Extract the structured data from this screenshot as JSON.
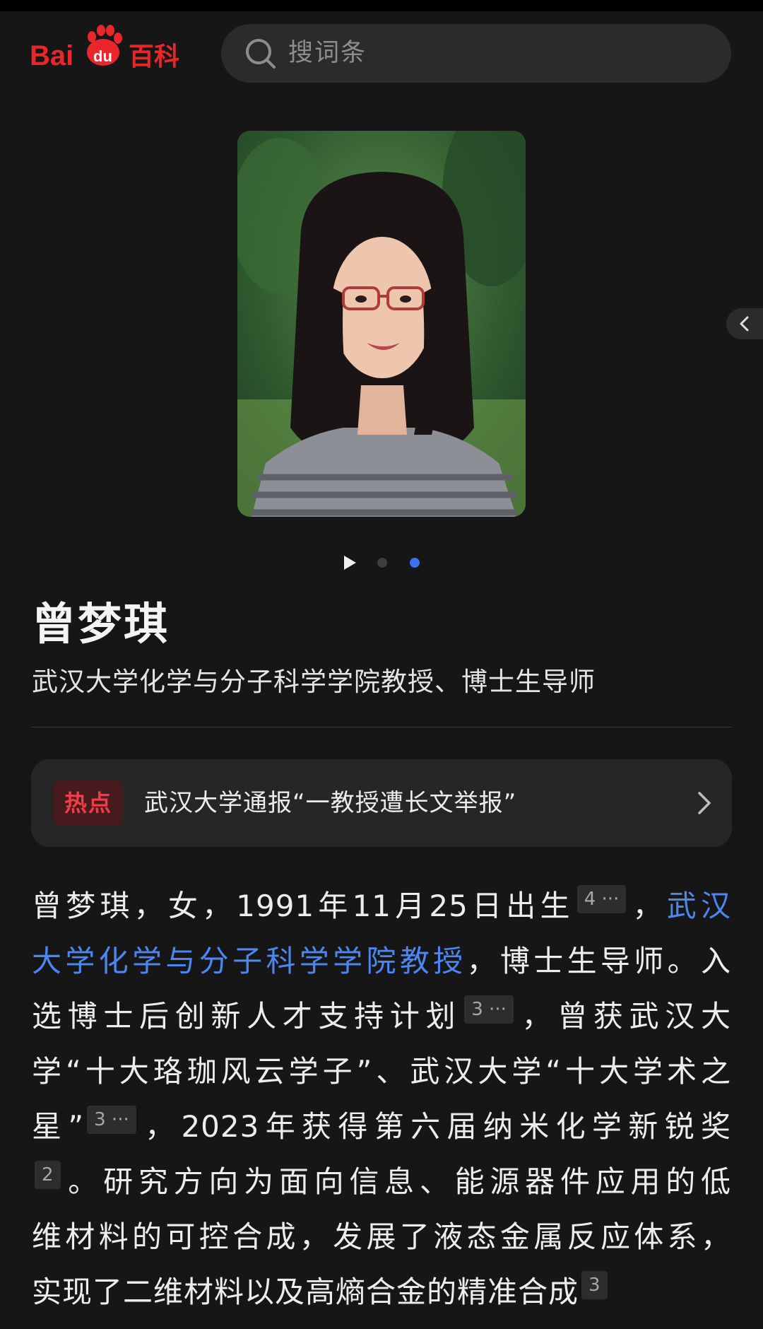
{
  "header": {
    "logo_text_bai": "Bai",
    "logo_text_du": "du",
    "logo_text_baike": "百科",
    "search_placeholder": "搜词条"
  },
  "person": {
    "name": "曾梦琪",
    "subtitle": "武汉大学化学与分子科学学院教授、博士生导师"
  },
  "hot": {
    "badge": "热点",
    "text": "武汉大学通报“一教授遭长文举报”"
  },
  "body": {
    "l1_a": "曾梦琪，女，1991年11月25日出生",
    "l1_ref": "4 ···",
    "l1_b": "，",
    "l1_link": "武汉",
    "l2_link": "大学化学与分子科学学院教授",
    "l2_b": "，博士生导师。入",
    "l3_a": "选博士后创新人才支持计划",
    "l3_ref": "3 ···",
    "l3_b": "，曾获武汉大",
    "l4": "学“十大珞珈风云学子”、武汉大学“十大学术之",
    "l5_a": "星”",
    "l5_ref": "3 ···",
    "l5_b": "，2023年获得第六届纳米化学新锐奖",
    "l6_ref": "2",
    "l6_b": "。研究方向为面向信息、能源器件应用的低",
    "l7": "维材料的可控合成，发展了液态金属反应体系，",
    "l8_a": "实现了二维材料以及高熵合金的精准合成",
    "l8_ref": "3"
  },
  "colors": {
    "background": "#161616",
    "link": "#4c86f1",
    "hot_red": "#ef3e47",
    "active_dot": "#3f6ff2",
    "logo_red": "#e8262b"
  },
  "carousel": {
    "total_dots": 2,
    "active_index": 2,
    "has_play": true
  }
}
